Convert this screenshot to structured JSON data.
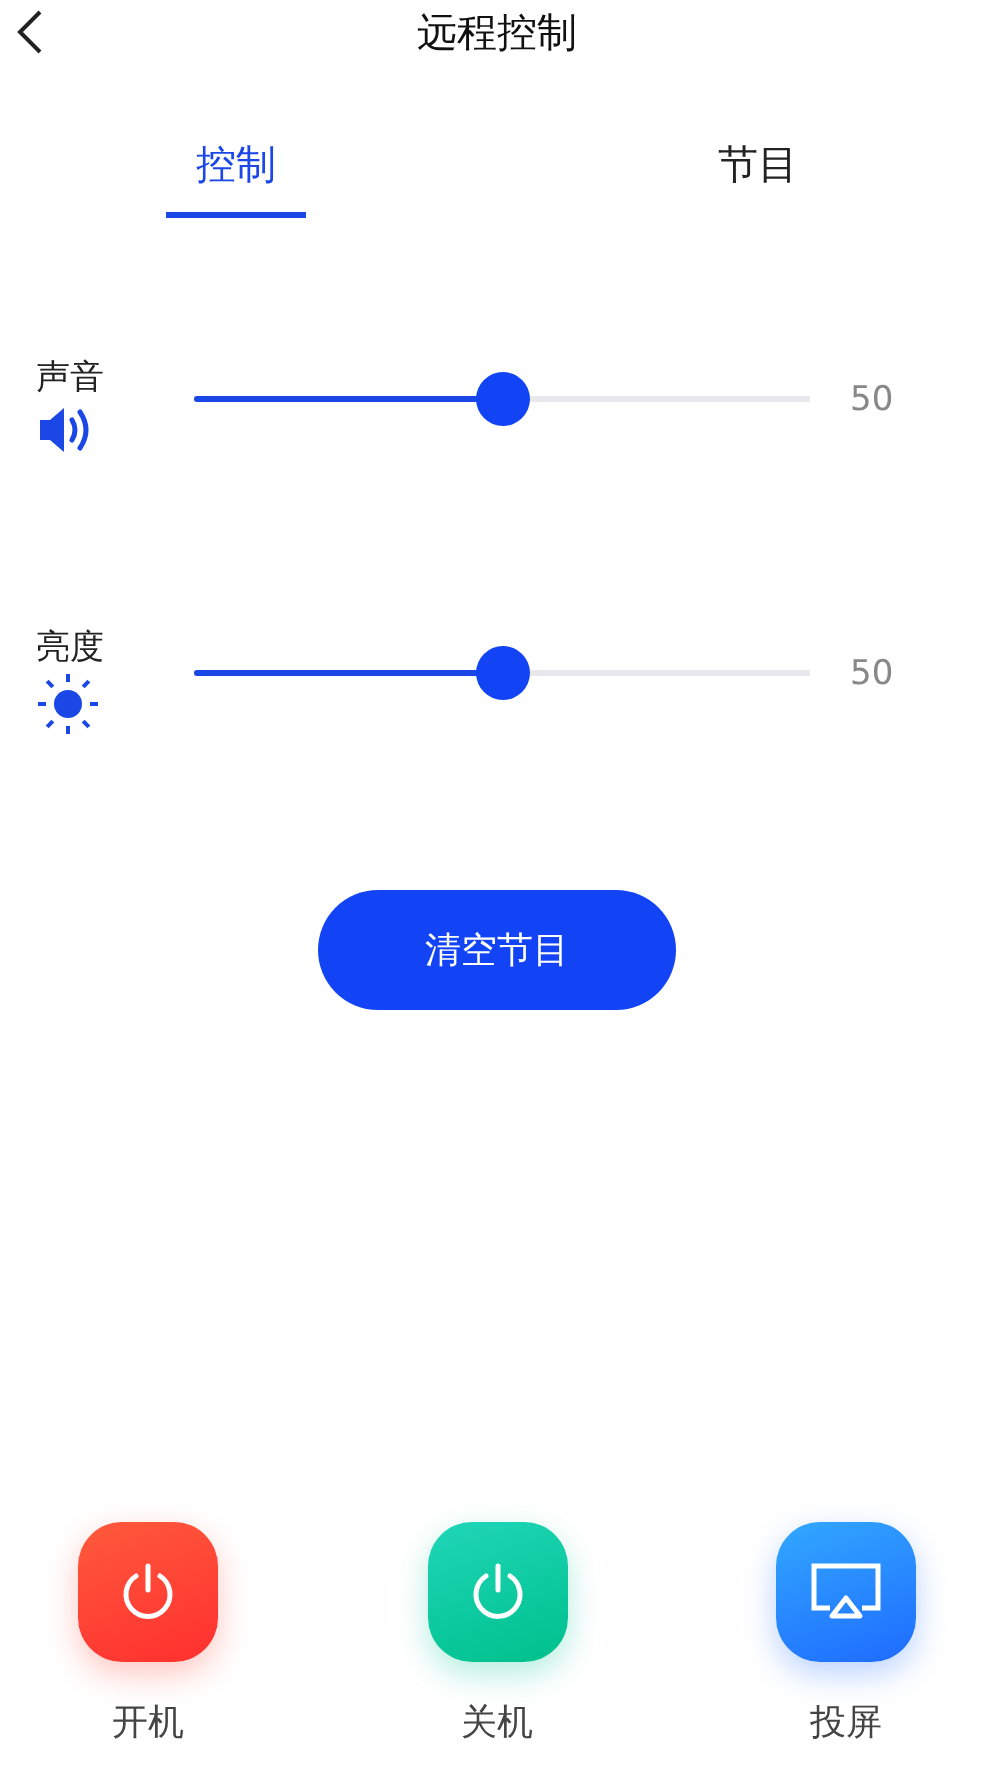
{
  "header": {
    "title": "远程控制"
  },
  "tabs": [
    {
      "label": "控制",
      "selected": true
    },
    {
      "label": "节目",
      "selected": false
    }
  ],
  "sliders": [
    {
      "kind": "volume",
      "label": "声音",
      "level": 0.5,
      "reading": "50"
    },
    {
      "kind": "brightness",
      "label": "亮度",
      "level": 0.5,
      "reading": "50"
    }
  ],
  "clear_button": "清空节目",
  "actions": [
    {
      "kind": "power_on",
      "label": "开机"
    },
    {
      "kind": "power_off",
      "label": "关机"
    },
    {
      "kind": "cast",
      "label": "投屏"
    }
  ]
}
